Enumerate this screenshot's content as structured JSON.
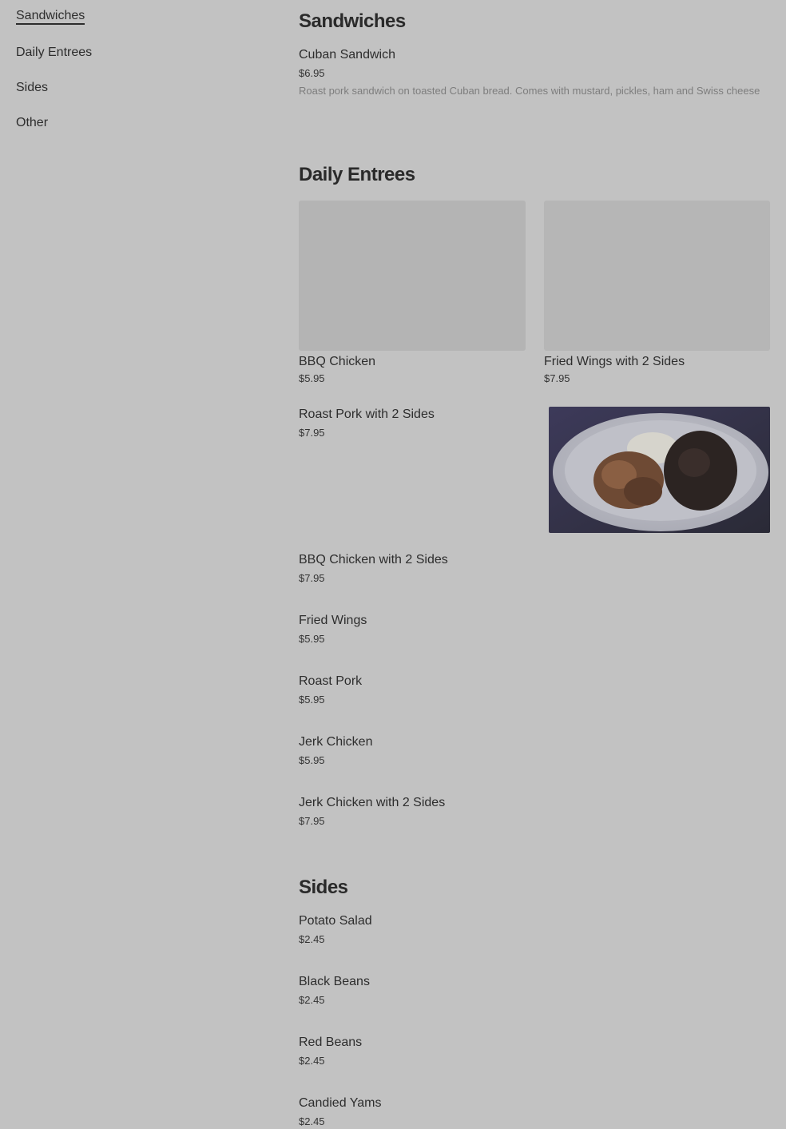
{
  "nav": {
    "items": [
      {
        "label": "Sandwiches"
      },
      {
        "label": "Daily Entrees"
      },
      {
        "label": "Sides"
      },
      {
        "label": "Other"
      }
    ]
  },
  "sections": {
    "sandwiches": {
      "title": "Sandwiches",
      "items": [
        {
          "name": "Cuban Sandwich",
          "price": "$6.95",
          "description": "Roast pork sandwich on toasted Cuban bread. Comes with mustard, pickles, ham and Swiss cheese"
        }
      ]
    },
    "daily_entrees": {
      "title": "Daily Entrees",
      "cards": [
        {
          "name": "BBQ Chicken",
          "price": "$5.95"
        },
        {
          "name": "Fried Wings with 2 Sides",
          "price": "$7.95"
        }
      ],
      "featured": {
        "name": "Roast Pork with 2 Sides",
        "price": "$7.95"
      },
      "items": [
        {
          "name": "BBQ Chicken with 2 Sides",
          "price": "$7.95"
        },
        {
          "name": "Fried Wings",
          "price": "$5.95"
        },
        {
          "name": "Roast Pork",
          "price": "$5.95"
        },
        {
          "name": "Jerk Chicken",
          "price": "$5.95"
        },
        {
          "name": "Jerk Chicken with 2 Sides",
          "price": "$7.95"
        }
      ]
    },
    "sides": {
      "title": "Sides",
      "items": [
        {
          "name": "Potato Salad",
          "price": "$2.45"
        },
        {
          "name": "Black Beans",
          "price": "$2.45"
        },
        {
          "name": "Red Beans",
          "price": "$2.45"
        },
        {
          "name": "Candied Yams",
          "price": "$2.45"
        }
      ]
    }
  }
}
